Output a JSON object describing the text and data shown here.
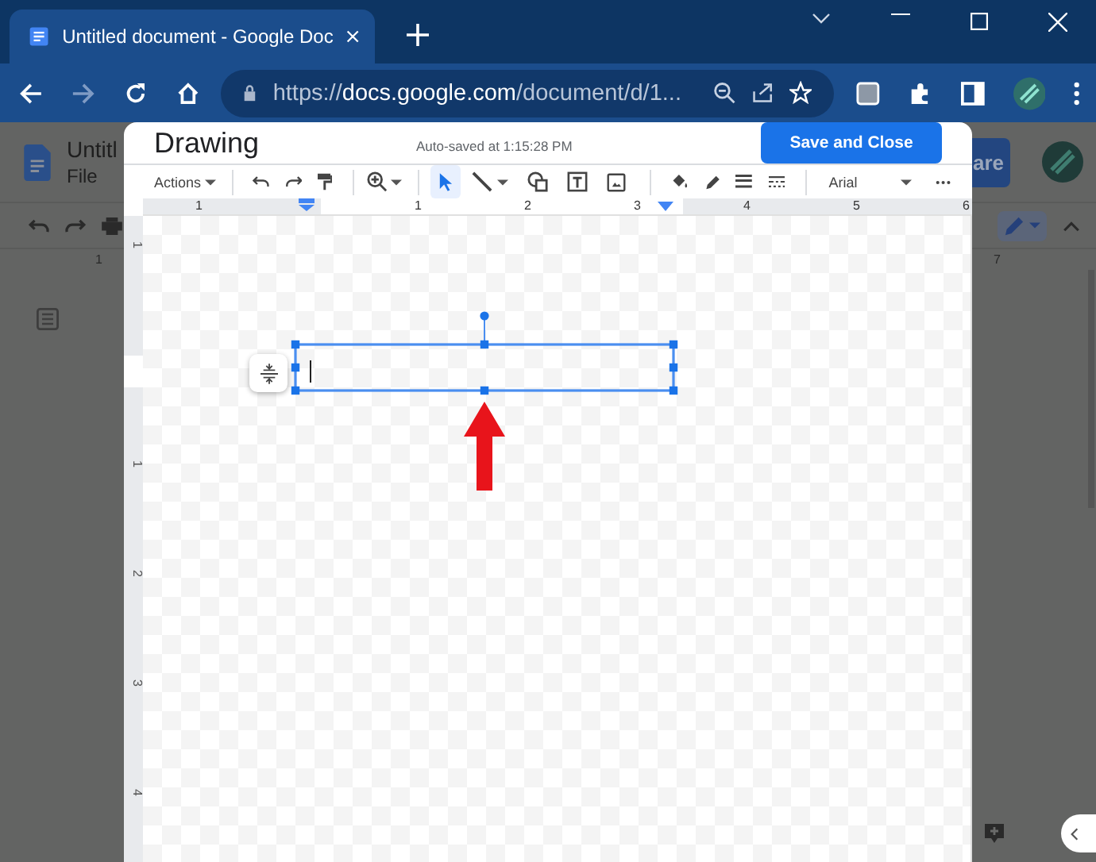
{
  "browser": {
    "tab_title": "Untitled document - Google Doc",
    "url_scheme": "https://",
    "url_host": "docs.google.com",
    "url_path": "/document/d/1..."
  },
  "document": {
    "title": "Untitl",
    "menu": "File",
    "share_label": "are",
    "ruler_labels": [
      "1",
      "7"
    ]
  },
  "dialog": {
    "title": "Drawing",
    "autosave": "Auto-saved at 1:15:28 PM",
    "save_button": "Save and Close",
    "actions_label": "Actions",
    "font": "Arial",
    "tools": [
      {
        "selected": true
      },
      {
        "selected": false
      },
      {
        "selected": false
      },
      {
        "selected": false
      },
      {
        "selected": false
      }
    ],
    "ruler_labels": [
      "1",
      "1",
      "2",
      "3",
      "4",
      "5",
      "6"
    ],
    "vertical_ruler_labels": [
      "1",
      "1",
      "2",
      "3",
      "4"
    ]
  }
}
